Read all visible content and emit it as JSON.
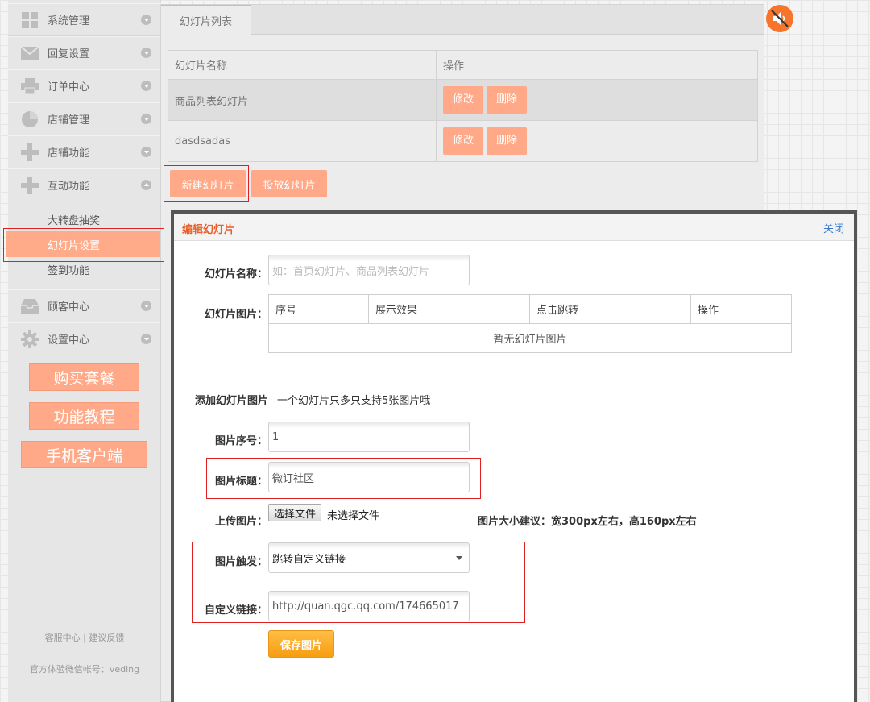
{
  "sidebar": {
    "menu": [
      {
        "label": "系统管理",
        "icon": "grid-icon"
      },
      {
        "label": "回复设置",
        "icon": "mail-icon"
      },
      {
        "label": "订单中心",
        "icon": "printer-icon"
      },
      {
        "label": "店铺管理",
        "icon": "pie-chart-icon"
      },
      {
        "label": "店铺功能",
        "icon": "plus-icon"
      },
      {
        "label": "互动功能",
        "icon": "plus-icon"
      },
      {
        "label": "顾客中心",
        "icon": "inbox-icon"
      },
      {
        "label": "设置中心",
        "icon": "gear-icon"
      }
    ],
    "submenu": [
      "大转盘抽奖",
      "幻灯片设置",
      "签到功能"
    ],
    "active_sub": "幻灯片设置",
    "buttons": {
      "buy": "购买套餐",
      "tutorial": "功能教程",
      "mobile": "手机客户端"
    },
    "footer": {
      "support": "客服中心",
      "separator": "|",
      "feedback": "建议反馈",
      "account": "官方体验微信帐号：veding"
    }
  },
  "main": {
    "tab": "幻灯片列表",
    "table": {
      "headers": [
        "幻灯片名称",
        "操作"
      ],
      "rows": [
        {
          "name": "商品列表幻灯片",
          "edit": "修改",
          "delete": "删除"
        },
        {
          "name": "dasdsadas",
          "edit": "修改",
          "delete": "删除"
        }
      ]
    },
    "actions": {
      "new": "新建幻灯片",
      "publish": "投放幻灯片"
    }
  },
  "modal": {
    "title": "编辑幻灯片",
    "close": "关闭",
    "name_label": "幻灯片名称：",
    "name_placeholder": "如：首页幻灯片、商品列表幻灯片",
    "pics_label": "幻灯片图片：",
    "pics_table": {
      "headers": [
        "序号",
        "展示效果",
        "点击跳转",
        "操作"
      ],
      "empty": "暂无幻灯片图片"
    },
    "add_title": "添加幻灯片图片",
    "add_hint": "一个幻灯片只多只支持5张图片哦",
    "order_label": "图片序号：",
    "order_value": "1",
    "title_label": "图片标题：",
    "title_value": "微订社区",
    "upload_label": "上传图片：",
    "file_button": "选择文件",
    "file_status": "未选择文件",
    "size_hint": "图片大小建议：宽300px左右，高160px左右",
    "trigger_label": "图片触发：",
    "trigger_value": "跳转自定义链接",
    "link_label": "自定义链接：",
    "link_value": "http://quan.qgc.qq.com/174665017",
    "save": "保存图片"
  },
  "colors": {
    "accent": "#ffa989",
    "modal_title": "#e8602c",
    "save": "#f7a21b",
    "highlight": "#e02020",
    "close_link": "#3a7ad2"
  }
}
